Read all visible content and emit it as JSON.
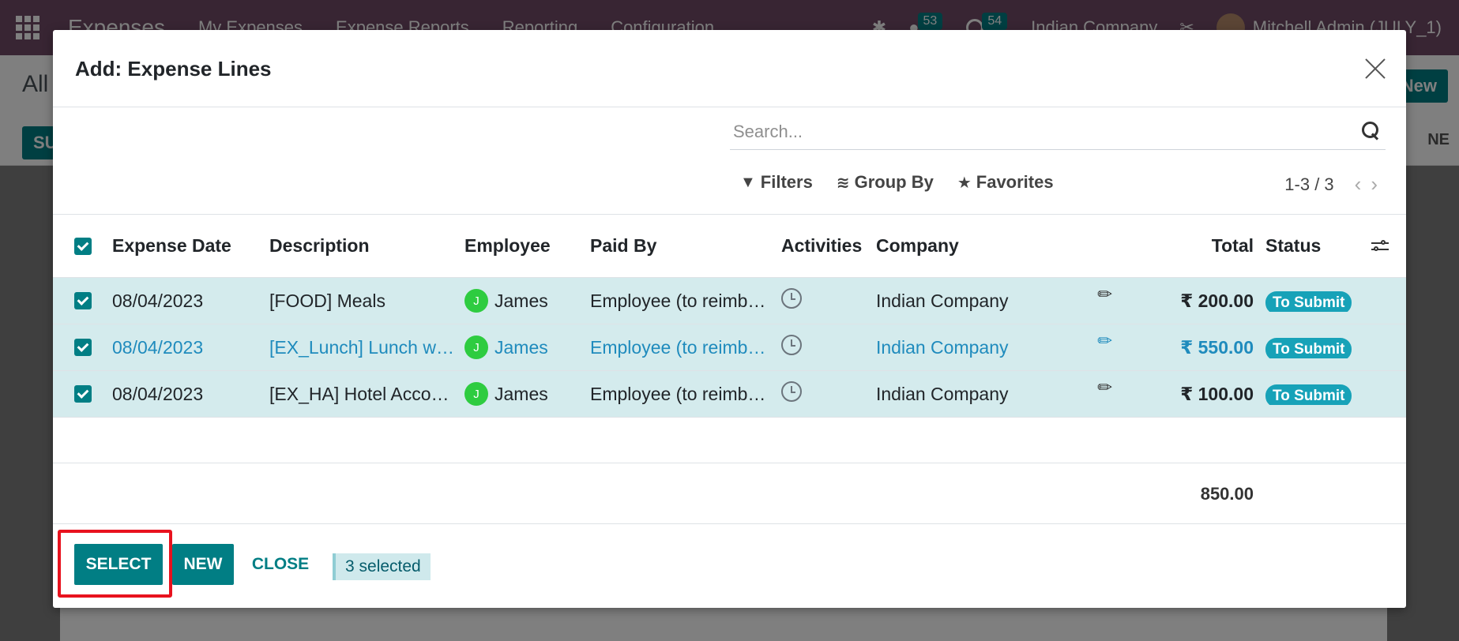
{
  "navbar": {
    "brand": "Expenses",
    "menu": [
      "My Expenses",
      "Expense Reports",
      "Reporting",
      "Configuration"
    ],
    "messages_count": "53",
    "activities_count": "54",
    "company": "Indian Company",
    "user": "Mitchell Admin (JULY_1)"
  },
  "background": {
    "title": "All",
    "new_label": "New",
    "submit_label": "SU",
    "right_label": "NE"
  },
  "modal": {
    "title": "Add: Expense Lines",
    "search_placeholder": "Search...",
    "filters_label": "Filters",
    "groupby_label": "Group By",
    "favorites_label": "Favorites",
    "pager_text": "1-3 / 3",
    "columns": {
      "date": "Expense Date",
      "description": "Description",
      "employee": "Employee",
      "paid_by": "Paid By",
      "activities": "Activities",
      "company": "Company",
      "total": "Total",
      "status": "Status"
    },
    "rows": [
      {
        "date": "08/04/2023",
        "description": "[FOOD] Meals",
        "employee": "James",
        "employee_initial": "J",
        "paid_by": "Employee (to reimburse)",
        "company": "Indian Company",
        "total": "₹ 200.00",
        "status": "To Submit"
      },
      {
        "date": "08/04/2023",
        "description": "[EX_Lunch] Lunch with customer",
        "employee": "James",
        "employee_initial": "J",
        "paid_by": "Employee (to reimburse)",
        "company": "Indian Company",
        "total": "₹ 550.00",
        "status": "To Submit"
      },
      {
        "date": "08/04/2023",
        "description": "[EX_HA] Hotel Accommodation",
        "employee": "James",
        "employee_initial": "J",
        "paid_by": "Employee (to reimburse)",
        "company": "Indian Company",
        "total": "₹ 100.00",
        "status": "To Submit"
      }
    ],
    "grand_total": "850.00",
    "buttons": {
      "select": "SELECT",
      "new": "NEW",
      "close": "CLOSE"
    },
    "selected_text": "3 selected"
  },
  "colors": {
    "navbar": "#714b67",
    "primary": "#017e84",
    "selected_row": "#d4ebed",
    "status_badge": "#17a2b8",
    "highlight": "#e8121e"
  }
}
